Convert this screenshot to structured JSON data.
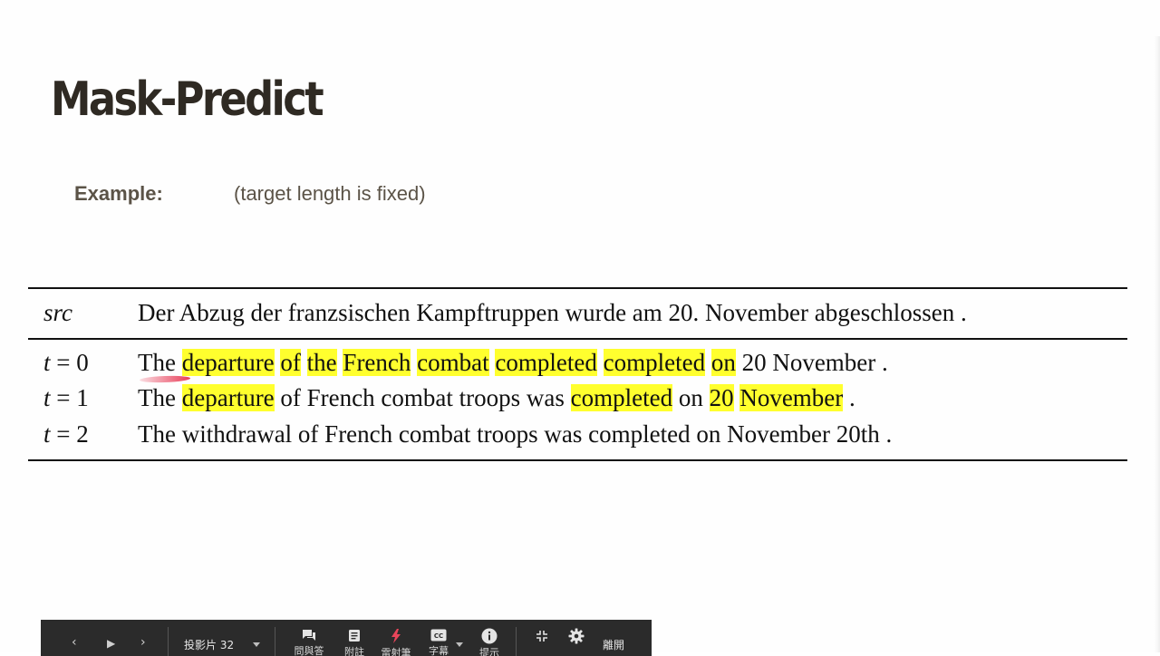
{
  "slide": {
    "title": "Mask-Predict",
    "example_label": "Example:",
    "example_note": "(target length is fixed)"
  },
  "table": {
    "rows": [
      {
        "label_var": "src",
        "label_eq": "",
        "segments": [
          {
            "text": "Der Abzug der franzsischen Kampftruppen wurde am 20. November abgeschlossen .",
            "hl": false
          }
        ]
      },
      {
        "label_var": "t",
        "label_eq": " = 0",
        "segments": [
          {
            "text": "The ",
            "hl": false
          },
          {
            "text": "departure",
            "hl": true
          },
          {
            "text": " ",
            "hl": false
          },
          {
            "text": "of",
            "hl": true
          },
          {
            "text": " ",
            "hl": false
          },
          {
            "text": "the",
            "hl": true
          },
          {
            "text": " ",
            "hl": false
          },
          {
            "text": "French",
            "hl": true
          },
          {
            "text": " ",
            "hl": false
          },
          {
            "text": "combat",
            "hl": true
          },
          {
            "text": " ",
            "hl": false
          },
          {
            "text": "completed",
            "hl": true
          },
          {
            "text": " ",
            "hl": false
          },
          {
            "text": "completed",
            "hl": true
          },
          {
            "text": " ",
            "hl": false
          },
          {
            "text": "on",
            "hl": true
          },
          {
            "text": " 20 November .",
            "hl": false
          }
        ]
      },
      {
        "label_var": "t",
        "label_eq": " = 1",
        "segments": [
          {
            "text": "The ",
            "hl": false
          },
          {
            "text": "departure",
            "hl": true
          },
          {
            "text": " of French combat troops was ",
            "hl": false
          },
          {
            "text": "completed",
            "hl": true
          },
          {
            "text": " on ",
            "hl": false
          },
          {
            "text": "20",
            "hl": true
          },
          {
            "text": " ",
            "hl": false
          },
          {
            "text": "November",
            "hl": true
          },
          {
            "text": " .",
            "hl": false
          }
        ]
      },
      {
        "label_var": "t",
        "label_eq": " = 2",
        "segments": [
          {
            "text": "The withdrawal of French combat troops was completed on November 20th .",
            "hl": false
          }
        ]
      }
    ]
  },
  "toolbar": {
    "prev_glyph": "‹",
    "play_glyph": "▶",
    "next_glyph": "›",
    "slide_selector": "投影片 32",
    "qa_label": "問與答",
    "notes_label": "附註",
    "laser_label": "雷射筆",
    "captions_label": "字幕",
    "tips_label": "提示",
    "exit_label": "離開",
    "icons": [
      "chevron-left-icon",
      "play-icon",
      "chevron-right-icon",
      "chat-icon",
      "notes-icon",
      "laser-pointer-icon",
      "captions-icon",
      "info-icon",
      "shrink-icon",
      "gear-icon"
    ]
  },
  "colors": {
    "highlight": "#ffff2e",
    "title": "#2f2a23",
    "subtitle": "#5b5347",
    "toolbar_bg": "#2b2b2b"
  }
}
